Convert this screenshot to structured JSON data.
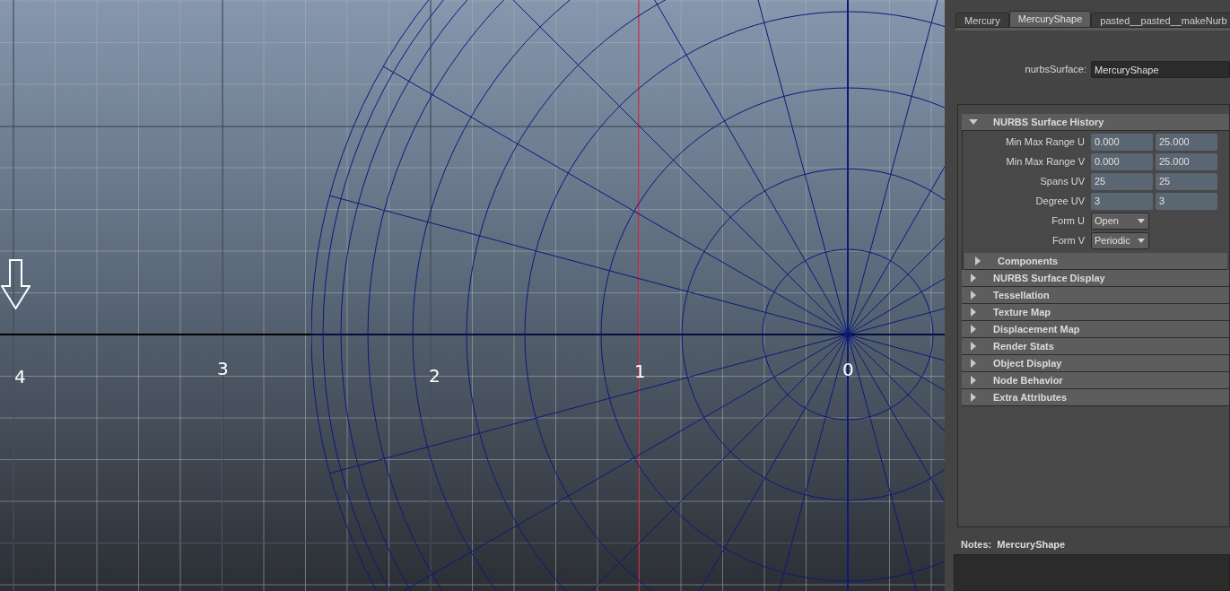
{
  "viewport": {
    "axis_labels": [
      "4",
      "3",
      "2",
      "1",
      "0"
    ]
  },
  "attribute_editor": {
    "tabs": [
      {
        "label": "Mercury",
        "selected": false
      },
      {
        "label": "MercuryShape",
        "selected": true
      },
      {
        "label": "pasted__pasted__makeNurb",
        "selected": false
      }
    ],
    "node_field": {
      "label": "nurbsSurface:",
      "value": "MercuryShape"
    },
    "sections": [
      {
        "title": "NURBS Surface History",
        "expanded": true,
        "attributes": [
          {
            "kind": "pair",
            "label": "Min Max Range U",
            "values": [
              "0.000",
              "25.000"
            ]
          },
          {
            "kind": "pair",
            "label": "Min Max Range V",
            "values": [
              "0.000",
              "25.000"
            ]
          },
          {
            "kind": "pair",
            "label": "Spans UV",
            "values": [
              "25",
              "25"
            ]
          },
          {
            "kind": "pair",
            "label": "Degree UV",
            "values": [
              "3",
              "3"
            ]
          },
          {
            "kind": "dropdown",
            "label": "Form U",
            "value": "Open"
          },
          {
            "kind": "dropdown",
            "label": "Form V",
            "value": "Periodic"
          }
        ],
        "subsections": [
          {
            "title": "Components",
            "expanded": false
          }
        ]
      },
      {
        "title": "NURBS Surface Display",
        "expanded": false
      },
      {
        "title": "Tessellation",
        "expanded": false
      },
      {
        "title": "Texture Map",
        "expanded": false
      },
      {
        "title": "Displacement Map",
        "expanded": false
      },
      {
        "title": "Render Stats",
        "expanded": false
      },
      {
        "title": "Object Display",
        "expanded": false
      },
      {
        "title": "Node Behavior",
        "expanded": false
      },
      {
        "title": "Extra Attributes",
        "expanded": false
      }
    ],
    "notes": {
      "label": "Notes:  MercuryShape"
    }
  }
}
